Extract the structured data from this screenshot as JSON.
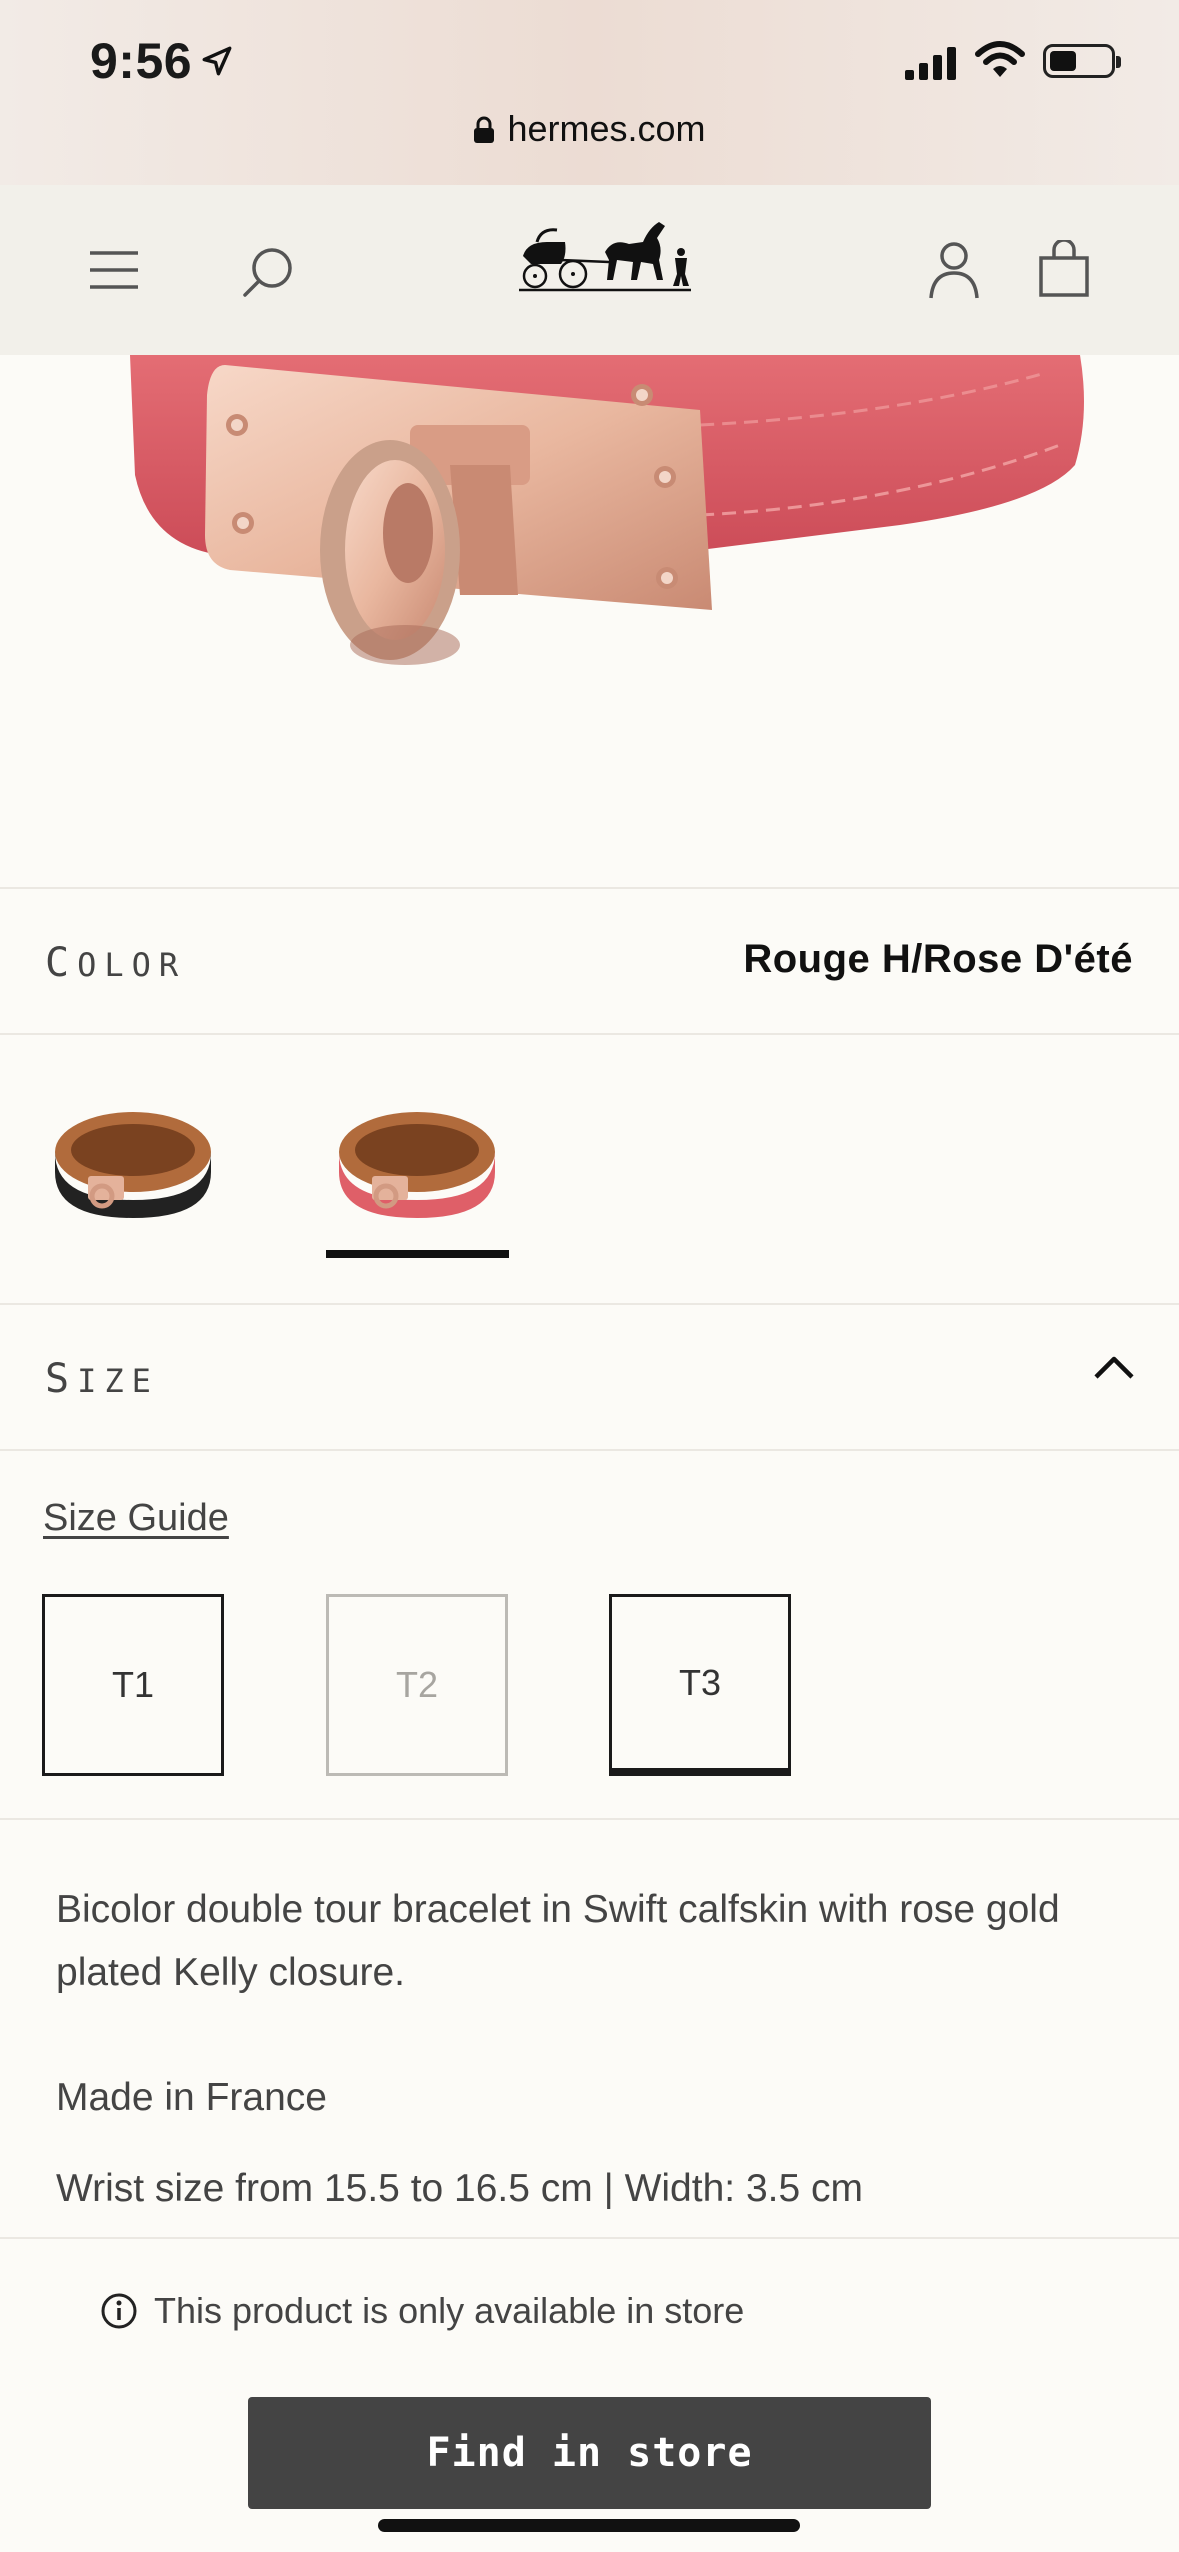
{
  "status_bar": {
    "time": "9:56",
    "url": "hermes.com",
    "icons": [
      "location-arrow-icon",
      "signal-icon",
      "wifi-icon",
      "battery-icon",
      "lock-icon"
    ]
  },
  "nav": {
    "icons": [
      "menu-icon",
      "search-icon",
      "hermes-carriage-logo",
      "account-icon",
      "shopping-bag-icon"
    ]
  },
  "color_section": {
    "label": "Color",
    "value": "Rouge H/Rose D'été",
    "swatches": [
      {
        "name": "black",
        "selected": false
      },
      {
        "name": "rouge-h-rose-dete",
        "selected": true
      }
    ]
  },
  "size_section": {
    "label": "Size",
    "expanded": true,
    "size_guide": "Size Guide",
    "sizes": [
      {
        "label": "T1",
        "state": "available"
      },
      {
        "label": "T2",
        "state": "unavailable"
      },
      {
        "label": "T3",
        "state": "selected"
      }
    ]
  },
  "description": {
    "text": "Bicolor double tour bracelet in Swift calfskin with rose gold plated Kelly closure.",
    "origin": "Made in France",
    "dimensions": "Wrist size from 15.5 to 16.5 cm | Width: 3.5 cm"
  },
  "availability": {
    "note": "This product is only available in store",
    "button": "Find in store"
  },
  "colors": {
    "background": "#fcfbf7",
    "navbar": "#f2f0ea",
    "button": "#444444",
    "leather_pink": "#e0606a",
    "rose_gold": "#e8b9a3"
  }
}
